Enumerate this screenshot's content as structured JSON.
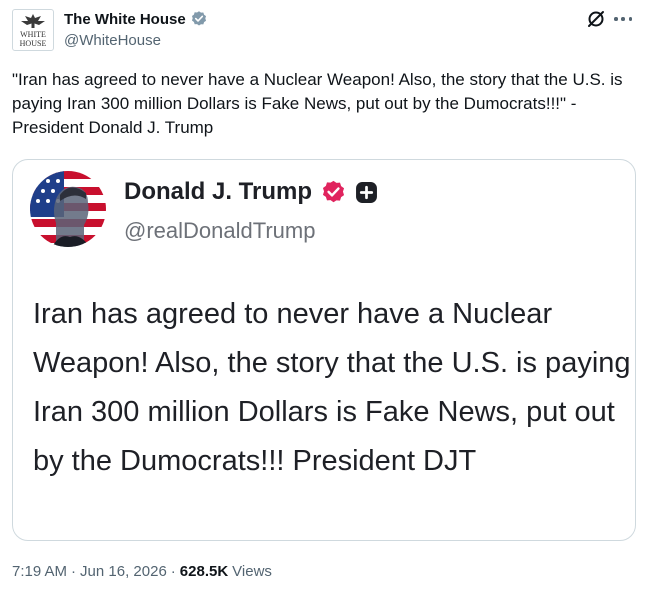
{
  "post": {
    "author_name": "The White House",
    "author_handle": "@WhiteHouse",
    "avatar_text_top": "WHITE",
    "avatar_text_bottom": "HOUSE",
    "text": "\"Iran has agreed to never have a Nuclear Weapon! Also, the story that the U.S. is paying Iran 300 million Dollars is Fake News, put out by the Dumocrats!!!\" - President Donald J. Trump",
    "icons": {
      "grok": "grok-icon",
      "more": "more-options-icon",
      "verified": "gray-verified-badge-icon"
    }
  },
  "quote": {
    "author_name": "Donald J. Trump",
    "author_handle": "@realDonaldTrump",
    "text": "Iran has agreed to never have a Nuclear Weapon! Also, the story that the U.S. is paying Iran 300 million Dollars is Fake News, put out by the Dumocrats!!! President DJT",
    "icons": {
      "verified": "verified-badge-icon",
      "plus": "plus-badge-icon"
    },
    "colors": {
      "verified_badge": "#e0245e"
    }
  },
  "meta": {
    "time": "7:19 AM",
    "date": "Jun 16, 2026",
    "views_count": "628.5K",
    "views_label": "Views"
  }
}
